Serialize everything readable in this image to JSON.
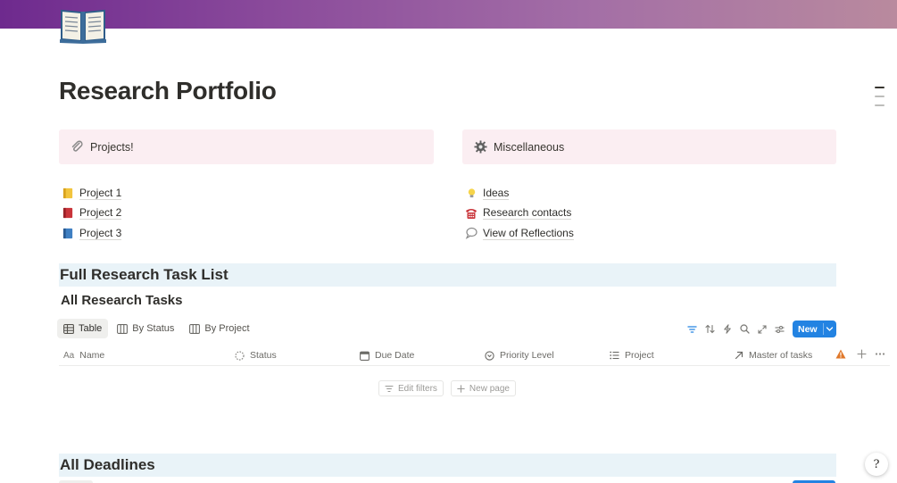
{
  "page": {
    "title": "Research Portfolio",
    "icon": "open-book-icon"
  },
  "callouts": {
    "left": {
      "icon": "paperclip-icon",
      "label": "Projects!"
    },
    "right": {
      "icon": "gear-icon",
      "label": "Miscellaneous"
    }
  },
  "links_left": [
    {
      "icon": "yellow-book-icon",
      "label": "Project 1"
    },
    {
      "icon": "red-book-icon",
      "label": "Project 2"
    },
    {
      "icon": "blue-book-icon",
      "label": "Project 3"
    }
  ],
  "links_right": [
    {
      "icon": "lightbulb-icon",
      "label": "Ideas"
    },
    {
      "icon": "telephone-icon",
      "label": "Research contacts"
    },
    {
      "icon": "speech-bubble-icon",
      "label": "View of Reflections"
    }
  ],
  "sections": {
    "full_list": "Full Research Task List",
    "deadlines": "All Deadlines"
  },
  "database": {
    "title": "All Research Tasks",
    "views": [
      {
        "label": "Table",
        "icon": "table-icon",
        "active": true
      },
      {
        "label": "By Status",
        "icon": "board-icon",
        "active": false
      },
      {
        "label": "By Project",
        "icon": "board-icon",
        "active": false
      }
    ],
    "toolbar": {
      "new_label": "New",
      "tools": [
        "filter-icon",
        "sort-icon",
        "lightning-icon",
        "search-icon",
        "expand-icon",
        "settings-sliders-icon"
      ]
    },
    "columns": [
      {
        "label": "Name",
        "icon": "text-aa-icon"
      },
      {
        "label": "Status",
        "icon": "status-dashed-circle-icon"
      },
      {
        "label": "Due Date",
        "icon": "calendar-icon"
      },
      {
        "label": "Priority Level",
        "icon": "select-circle-icon"
      },
      {
        "label": "Project",
        "icon": "list-icon"
      },
      {
        "label": "Master of tasks",
        "icon": "relation-arrow-icon"
      }
    ],
    "empty_actions": {
      "edit_filters": "Edit filters",
      "new_page": "New page"
    }
  },
  "colors": {
    "accent": "#2383e2",
    "callout_bg": "#fbeef2",
    "heading_band_bg": "#e9f3f8",
    "warning": "#e0782a"
  },
  "help_button": "?"
}
